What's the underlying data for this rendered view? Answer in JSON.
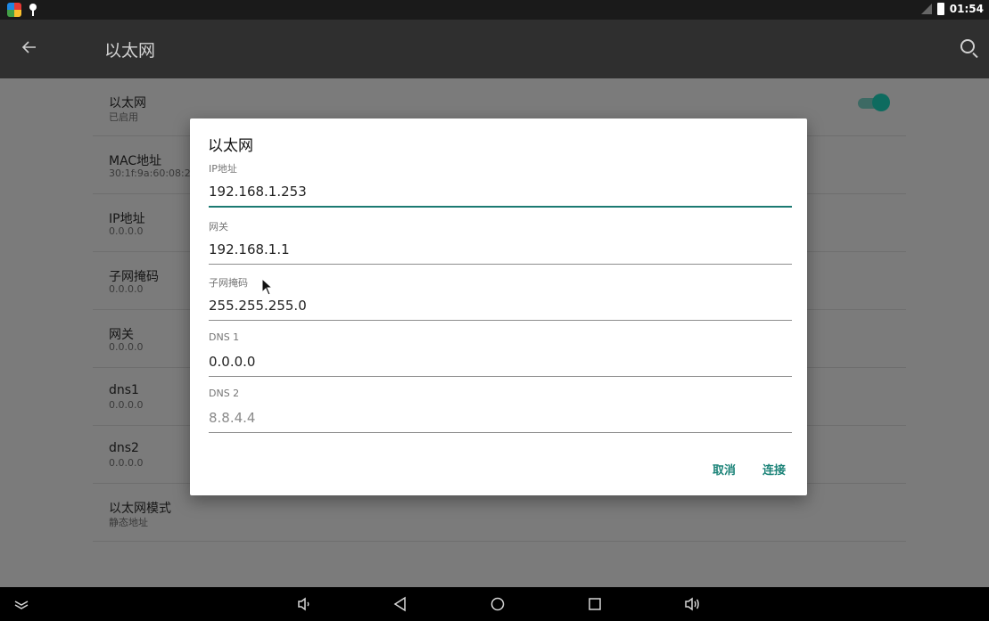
{
  "status_bar": {
    "time": "01:54"
  },
  "action_bar": {
    "title": "以太网"
  },
  "settings": {
    "rows": [
      {
        "title": "以太网",
        "subtitle": "已启用"
      },
      {
        "title": "MAC地址",
        "subtitle": "30:1f:9a:60:08:2"
      },
      {
        "title": "IP地址",
        "subtitle": "0.0.0.0"
      },
      {
        "title": "子网掩码",
        "subtitle": "0.0.0.0"
      },
      {
        "title": "网关",
        "subtitle": "0.0.0.0"
      },
      {
        "title": "dns1",
        "subtitle": "0.0.0.0"
      },
      {
        "title": "dns2",
        "subtitle": "0.0.0.0"
      },
      {
        "title": "以太网模式",
        "subtitle": "静态地址"
      }
    ],
    "ethernet_toggle_on": true
  },
  "dialog": {
    "title": "以太网",
    "fields": [
      {
        "label": "IP地址",
        "value": "192.168.1.253"
      },
      {
        "label": "网关",
        "value": "192.168.1.1"
      },
      {
        "label": "子网掩码",
        "value": "255.255.255.0"
      },
      {
        "label": "DNS 1",
        "value": "0.0.0.0"
      },
      {
        "label": "DNS 2",
        "placeholder": "8.8.4.4"
      }
    ],
    "cancel_label": "取消",
    "connect_label": "连接"
  },
  "colors": {
    "accent": "#1b8378",
    "toggle_thumb": "#0e6b5f",
    "action_bar": "#2f2f2f"
  }
}
